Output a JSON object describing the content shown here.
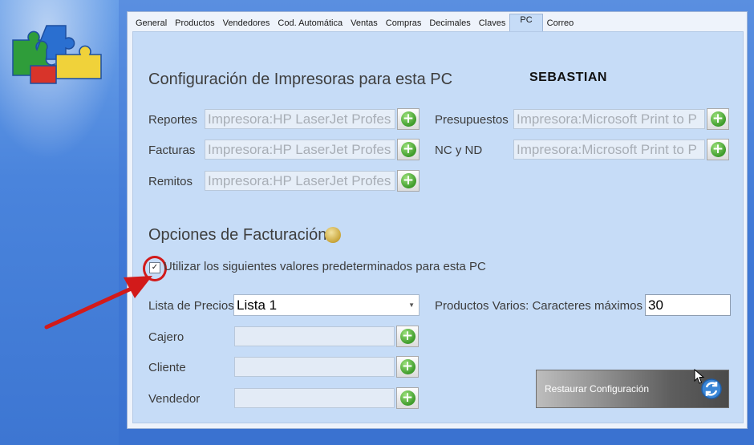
{
  "icons": {
    "logo": "puzzle-pieces-icon",
    "add": "green-plus-icon",
    "coin": "coin-icon",
    "refresh": "refresh-arrows-icon",
    "cursor": "mouse-pointer-icon"
  },
  "colors": {
    "accent_red": "#d21a1a",
    "plus_green": "#3f9c2b",
    "panel_bg": "#c6dcf7"
  },
  "tabs": [
    {
      "label": "General"
    },
    {
      "label": "Productos"
    },
    {
      "label": "Vendedores"
    },
    {
      "label": "Cod. Automática"
    },
    {
      "label": "Ventas"
    },
    {
      "label": "Compras"
    },
    {
      "label": "Decimales"
    },
    {
      "label": "Claves"
    },
    {
      "label": "PC",
      "active": true
    },
    {
      "label": "Correo"
    }
  ],
  "printers": {
    "title": "Configuración de Impresoras para esta PC",
    "pc_name": "SEBASTIAN",
    "reportes": {
      "label": "Reportes",
      "value": "Impresora:HP LaserJet Profes"
    },
    "facturas": {
      "label": "Facturas",
      "value": "Impresora:HP LaserJet Profes"
    },
    "remitos": {
      "label": "Remitos",
      "value": "Impresora:HP LaserJet Profes"
    },
    "presupuestos": {
      "label": "Presupuestos",
      "value": "Impresora:Microsoft Print to P"
    },
    "nc_nd": {
      "label": "NC y ND",
      "value": "Impresora:Microsoft Print to P"
    }
  },
  "billing": {
    "title": "Opciones de Facturación",
    "use_defaults": {
      "label": "Utilizar los siguientes valores predeterminados para esta PC",
      "checked": true,
      "mark": "✓"
    },
    "price_list": {
      "label": "Lista de Precios",
      "value": "Lista 1"
    },
    "cajero": {
      "label": "Cajero",
      "value": ""
    },
    "cliente": {
      "label": "Cliente",
      "value": ""
    },
    "vendedor": {
      "label": "Vendedor",
      "value": ""
    },
    "max_chars": {
      "label": "Productos Varios: Caracteres máximos",
      "value": "30"
    },
    "restore_button": "Restaurar Configuración"
  }
}
